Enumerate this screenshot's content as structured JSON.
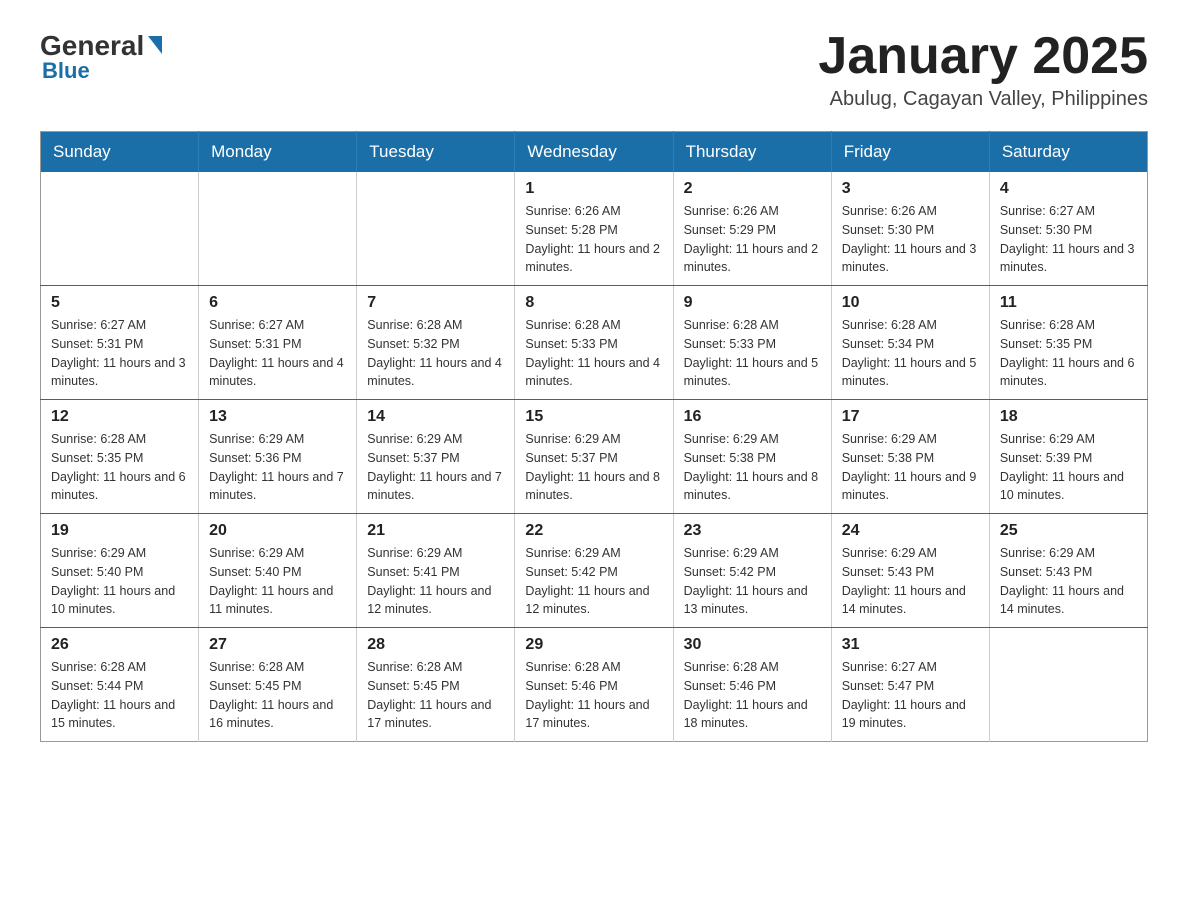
{
  "logo": {
    "general": "General",
    "blue": "Blue"
  },
  "header": {
    "month_year": "January 2025",
    "location": "Abulug, Cagayan Valley, Philippines"
  },
  "weekdays": [
    "Sunday",
    "Monday",
    "Tuesday",
    "Wednesday",
    "Thursday",
    "Friday",
    "Saturday"
  ],
  "weeks": [
    [
      {
        "day": "",
        "info": ""
      },
      {
        "day": "",
        "info": ""
      },
      {
        "day": "",
        "info": ""
      },
      {
        "day": "1",
        "info": "Sunrise: 6:26 AM\nSunset: 5:28 PM\nDaylight: 11 hours and 2 minutes."
      },
      {
        "day": "2",
        "info": "Sunrise: 6:26 AM\nSunset: 5:29 PM\nDaylight: 11 hours and 2 minutes."
      },
      {
        "day": "3",
        "info": "Sunrise: 6:26 AM\nSunset: 5:30 PM\nDaylight: 11 hours and 3 minutes."
      },
      {
        "day": "4",
        "info": "Sunrise: 6:27 AM\nSunset: 5:30 PM\nDaylight: 11 hours and 3 minutes."
      }
    ],
    [
      {
        "day": "5",
        "info": "Sunrise: 6:27 AM\nSunset: 5:31 PM\nDaylight: 11 hours and 3 minutes."
      },
      {
        "day": "6",
        "info": "Sunrise: 6:27 AM\nSunset: 5:31 PM\nDaylight: 11 hours and 4 minutes."
      },
      {
        "day": "7",
        "info": "Sunrise: 6:28 AM\nSunset: 5:32 PM\nDaylight: 11 hours and 4 minutes."
      },
      {
        "day": "8",
        "info": "Sunrise: 6:28 AM\nSunset: 5:33 PM\nDaylight: 11 hours and 4 minutes."
      },
      {
        "day": "9",
        "info": "Sunrise: 6:28 AM\nSunset: 5:33 PM\nDaylight: 11 hours and 5 minutes."
      },
      {
        "day": "10",
        "info": "Sunrise: 6:28 AM\nSunset: 5:34 PM\nDaylight: 11 hours and 5 minutes."
      },
      {
        "day": "11",
        "info": "Sunrise: 6:28 AM\nSunset: 5:35 PM\nDaylight: 11 hours and 6 minutes."
      }
    ],
    [
      {
        "day": "12",
        "info": "Sunrise: 6:28 AM\nSunset: 5:35 PM\nDaylight: 11 hours and 6 minutes."
      },
      {
        "day": "13",
        "info": "Sunrise: 6:29 AM\nSunset: 5:36 PM\nDaylight: 11 hours and 7 minutes."
      },
      {
        "day": "14",
        "info": "Sunrise: 6:29 AM\nSunset: 5:37 PM\nDaylight: 11 hours and 7 minutes."
      },
      {
        "day": "15",
        "info": "Sunrise: 6:29 AM\nSunset: 5:37 PM\nDaylight: 11 hours and 8 minutes."
      },
      {
        "day": "16",
        "info": "Sunrise: 6:29 AM\nSunset: 5:38 PM\nDaylight: 11 hours and 8 minutes."
      },
      {
        "day": "17",
        "info": "Sunrise: 6:29 AM\nSunset: 5:38 PM\nDaylight: 11 hours and 9 minutes."
      },
      {
        "day": "18",
        "info": "Sunrise: 6:29 AM\nSunset: 5:39 PM\nDaylight: 11 hours and 10 minutes."
      }
    ],
    [
      {
        "day": "19",
        "info": "Sunrise: 6:29 AM\nSunset: 5:40 PM\nDaylight: 11 hours and 10 minutes."
      },
      {
        "day": "20",
        "info": "Sunrise: 6:29 AM\nSunset: 5:40 PM\nDaylight: 11 hours and 11 minutes."
      },
      {
        "day": "21",
        "info": "Sunrise: 6:29 AM\nSunset: 5:41 PM\nDaylight: 11 hours and 12 minutes."
      },
      {
        "day": "22",
        "info": "Sunrise: 6:29 AM\nSunset: 5:42 PM\nDaylight: 11 hours and 12 minutes."
      },
      {
        "day": "23",
        "info": "Sunrise: 6:29 AM\nSunset: 5:42 PM\nDaylight: 11 hours and 13 minutes."
      },
      {
        "day": "24",
        "info": "Sunrise: 6:29 AM\nSunset: 5:43 PM\nDaylight: 11 hours and 14 minutes."
      },
      {
        "day": "25",
        "info": "Sunrise: 6:29 AM\nSunset: 5:43 PM\nDaylight: 11 hours and 14 minutes."
      }
    ],
    [
      {
        "day": "26",
        "info": "Sunrise: 6:28 AM\nSunset: 5:44 PM\nDaylight: 11 hours and 15 minutes."
      },
      {
        "day": "27",
        "info": "Sunrise: 6:28 AM\nSunset: 5:45 PM\nDaylight: 11 hours and 16 minutes."
      },
      {
        "day": "28",
        "info": "Sunrise: 6:28 AM\nSunset: 5:45 PM\nDaylight: 11 hours and 17 minutes."
      },
      {
        "day": "29",
        "info": "Sunrise: 6:28 AM\nSunset: 5:46 PM\nDaylight: 11 hours and 17 minutes."
      },
      {
        "day": "30",
        "info": "Sunrise: 6:28 AM\nSunset: 5:46 PM\nDaylight: 11 hours and 18 minutes."
      },
      {
        "day": "31",
        "info": "Sunrise: 6:27 AM\nSunset: 5:47 PM\nDaylight: 11 hours and 19 minutes."
      },
      {
        "day": "",
        "info": ""
      }
    ]
  ]
}
